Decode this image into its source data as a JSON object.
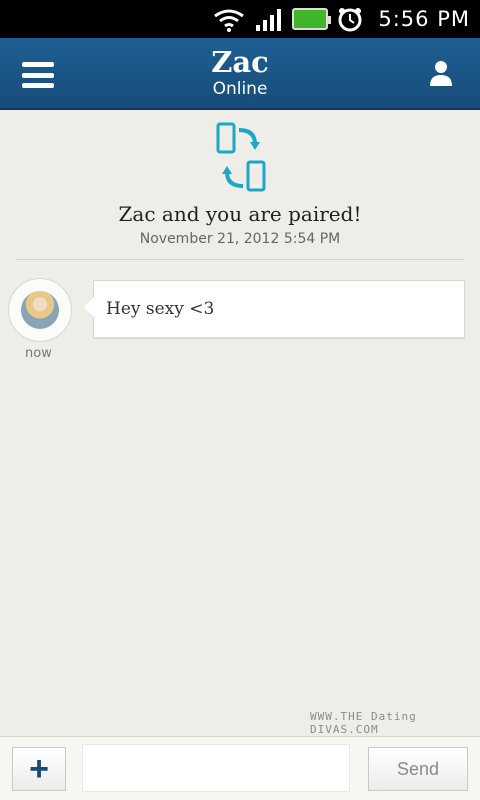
{
  "status_bar": {
    "time": "5:56 PM"
  },
  "header": {
    "contact_name": "Zac",
    "contact_status": "Online"
  },
  "chat": {
    "paired_message": "Zac and you are paired!",
    "paired_timestamp": "November 21, 2012 5:54 PM",
    "messages": [
      {
        "text": "Hey sexy <3",
        "time": "now"
      }
    ]
  },
  "watermark": "WWW.THE Dating DIVAS.COM",
  "composer": {
    "add_label": "+",
    "send_label": "Send",
    "placeholder": ""
  },
  "icons": {
    "menu": "menu-icon",
    "profile": "profile-icon",
    "pair": "pair-icon",
    "wifi": "wifi-icon",
    "signal": "signal-icon",
    "battery": "battery-icon",
    "alarm": "alarm-icon"
  },
  "colors": {
    "header": "#1e5f93",
    "accent": "#18a9c7",
    "chat_background": "#efede7"
  }
}
